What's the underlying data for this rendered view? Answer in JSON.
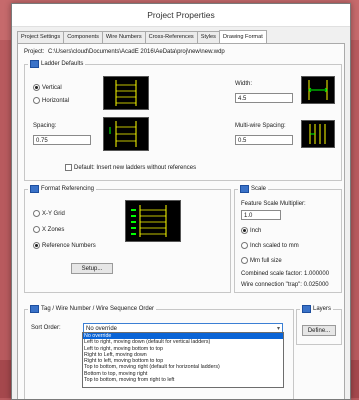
{
  "window": {
    "title": "Project Properties"
  },
  "tabs": [
    {
      "label": "Project Settings"
    },
    {
      "label": "Components"
    },
    {
      "label": "Wire Numbers"
    },
    {
      "label": "Cross-References"
    },
    {
      "label": "Styles"
    },
    {
      "label": "Drawing Format"
    }
  ],
  "project": {
    "label": "Project:",
    "path": "C:\\Users\\cloud\\Documents\\AcadE 2016\\AeData\\proj\\new\\new.wdp"
  },
  "ladder_defaults": {
    "title": "Ladder Defaults",
    "vertical_label": "Vertical",
    "horizontal_label": "Horizontal",
    "width_label": "Width:",
    "width_value": "4.5",
    "spacing_label": "Spacing:",
    "spacing_value": "0.75",
    "multiwire_label": "Multi-wire Spacing:",
    "multiwire_value": "0.5",
    "default_checkbox_label": "Default: Insert new ladders without references"
  },
  "format_referencing": {
    "title": "Format Referencing",
    "xy_grid_label": "X-Y Grid",
    "xzones_label": "X Zones",
    "reference_numbers_label": "Reference Numbers",
    "setup_label": "Setup..."
  },
  "scale": {
    "title": "Scale",
    "multiplier_label": "Feature Scale Multiplier:",
    "multiplier_value": "1.0",
    "inch_label": "Inch",
    "inch_scaled_label": "Inch scaled to mm",
    "mm_full_label": "Mm full size",
    "combined_label": "Combined scale factor: 1.000000",
    "wire_connection_label": "Wire connection \"trap\": 0.025000"
  },
  "tag_order": {
    "title": "Tag / Wire Number / Wire Sequence Order",
    "sort_label": "Sort Order:",
    "selected": "No override",
    "options": [
      "No override",
      "Left to right, moving down (default for vertical ladders)",
      "Left to right, moving bottom to top",
      "Right to Left, moving down",
      "Right to left, moving bottom to top",
      "Top to bottom, moving right (default for horizontal ladders)",
      "Bottom to top, moving right",
      "Top to bottom, moving from right to left"
    ]
  },
  "layers": {
    "title": "Layers",
    "define_label": "Define..."
  }
}
